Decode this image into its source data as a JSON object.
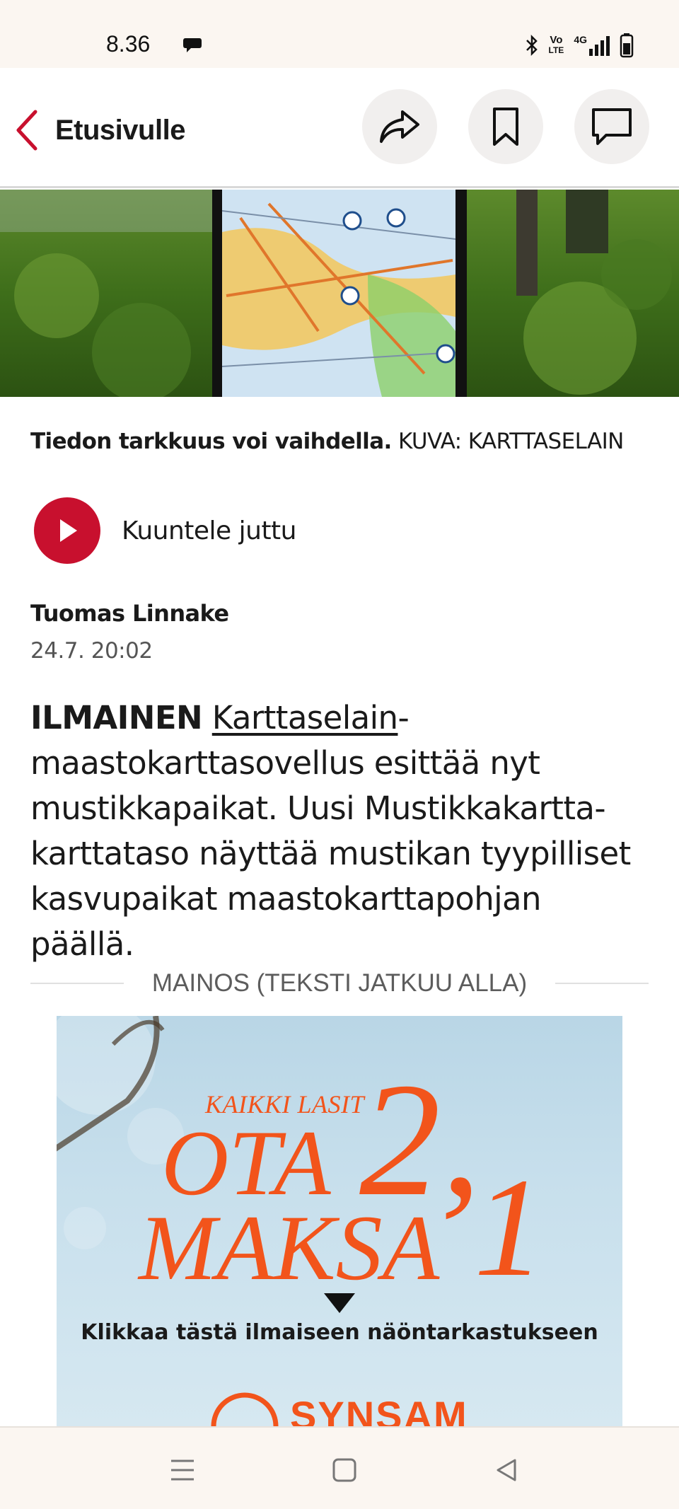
{
  "status_bar": {
    "time": "8.36",
    "volte_top": "Vo",
    "volte_bottom": "LTE",
    "network": "4G"
  },
  "header": {
    "back_label": "Etusivulle"
  },
  "image_caption": {
    "bold": "Tiedon tarkkuus voi vaihdella.",
    "credit": "KUVA: KARTTASELAIN"
  },
  "listen": {
    "label": "Kuuntele juttu"
  },
  "byline": {
    "author": "Tuomas Linnake",
    "date": "24.7. 20:02"
  },
  "lead": {
    "kicker": "ILMAINEN",
    "link": "Karttaselain",
    "text": "-maastokarttasovellus esittää nyt mustikkapaikat. Uusi Mustikkakartta-karttataso näyttää mustikan tyypilliset kasvupaikat maastokarttapohjan päällä."
  },
  "ad": {
    "separator": "MAINOS (TEKSTI JATKUU ALLA)",
    "small": "KAIKKI LASIT",
    "line1": "OTA",
    "line2": "MAKSA",
    "num1": "2,",
    "num2": "1",
    "cta": "Klikkaa tästä ilmaiseen näöntarkastukseen",
    "brand": "SYNSAM"
  },
  "colors": {
    "accent": "#c8102e",
    "ad_orange": "#f2541b",
    "system_bar": "#fbf6f1"
  },
  "icons": [
    "back-chevron-icon",
    "share-icon",
    "bookmark-icon",
    "comment-icon",
    "play-icon",
    "menu-icon",
    "home-icon",
    "back-triangle-icon"
  ]
}
